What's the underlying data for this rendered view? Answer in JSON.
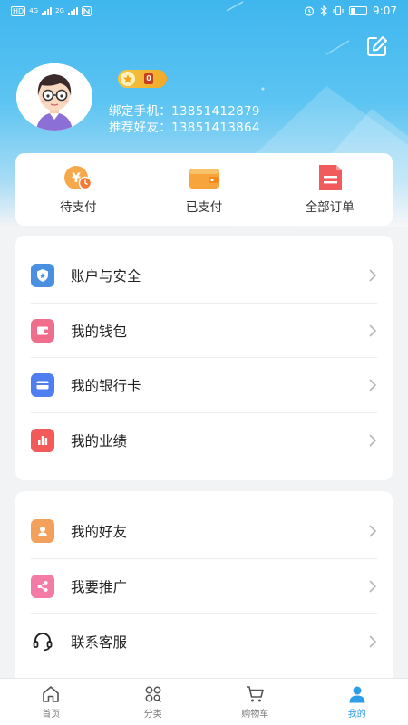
{
  "status_bar": {
    "net_tag": "HD",
    "signal_1": "4G",
    "signal_2": "2G",
    "time": "9:07"
  },
  "profile": {
    "badge_text": "0",
    "phone_label": "绑定手机：",
    "phone": "13851412879",
    "referrer_label": "推荐好友：",
    "referrer": "13851413864"
  },
  "orders": [
    {
      "label": "待支付",
      "icon": "pending-payment-icon"
    },
    {
      "label": "已支付",
      "icon": "wallet-paid-icon"
    },
    {
      "label": "全部订单",
      "icon": "all-orders-icon"
    }
  ],
  "menu_group_1": [
    {
      "label": "账户与安全",
      "icon": "shield-icon",
      "color": "#4a90e2"
    },
    {
      "label": "我的钱包",
      "icon": "wallet-icon",
      "color": "#f06d8c"
    },
    {
      "label": "我的银行卡",
      "icon": "bank-card-icon",
      "color": "#4f7ef0"
    },
    {
      "label": "我的业绩",
      "icon": "bar-chart-icon",
      "color": "#f25a5a"
    }
  ],
  "menu_group_2": [
    {
      "label": "我的好友",
      "icon": "friend-icon",
      "color": "#f3a05b"
    },
    {
      "label": "我要推广",
      "icon": "share-icon",
      "color": "#f57ba7"
    },
    {
      "label": "联系客服",
      "icon": "headset-icon",
      "color": "#222222"
    }
  ],
  "tabs": [
    {
      "label": "首页",
      "icon": "home-icon",
      "active": false
    },
    {
      "label": "分类",
      "icon": "category-icon",
      "active": false
    },
    {
      "label": "购物车",
      "icon": "cart-icon",
      "active": false
    },
    {
      "label": "我的",
      "icon": "user-icon",
      "active": true
    }
  ],
  "colors": {
    "header": "#3fb6ee",
    "accent": "#2d9de8",
    "badge": "#f6c445"
  }
}
